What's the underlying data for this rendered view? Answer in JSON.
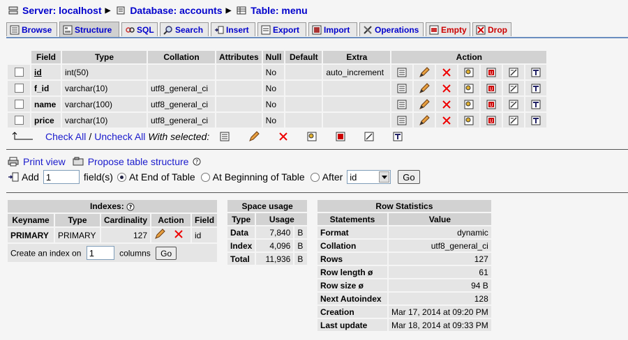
{
  "breadcrumb": {
    "server": "Server: localhost",
    "database": "Database: accounts",
    "table": "Table: menu"
  },
  "tabs": [
    {
      "label": "Browse",
      "icon": "browse-icon"
    },
    {
      "label": "Structure",
      "icon": "structure-icon",
      "active": true
    },
    {
      "label": "SQL",
      "icon": "sql-icon"
    },
    {
      "label": "Search",
      "icon": "search-icon"
    },
    {
      "label": "Insert",
      "icon": "insert-icon"
    },
    {
      "label": "Export",
      "icon": "export-icon"
    },
    {
      "label": "Import",
      "icon": "import-icon"
    },
    {
      "label": "Operations",
      "icon": "operations-icon"
    },
    {
      "label": "Empty",
      "icon": "empty-icon",
      "danger": true
    },
    {
      "label": "Drop",
      "icon": "drop-icon",
      "danger": true
    }
  ],
  "structure": {
    "headers": [
      "Field",
      "Type",
      "Collation",
      "Attributes",
      "Null",
      "Default",
      "Extra",
      "Action"
    ],
    "rows": [
      {
        "field": "id",
        "type": "int(50)",
        "collation": "",
        "attributes": "",
        "null": "No",
        "default": "",
        "extra": "auto_increment",
        "primary": true
      },
      {
        "field": "f_id",
        "type": "varchar(10)",
        "collation": "utf8_general_ci",
        "attributes": "",
        "null": "No",
        "default": "",
        "extra": ""
      },
      {
        "field": "name",
        "type": "varchar(100)",
        "collation": "utf8_general_ci",
        "attributes": "",
        "null": "No",
        "default": "",
        "extra": ""
      },
      {
        "field": "price",
        "type": "varchar(10)",
        "collation": "utf8_general_ci",
        "attributes": "",
        "null": "No",
        "default": "",
        "extra": ""
      }
    ]
  },
  "with_selected": {
    "check_all": "Check All",
    "separator": "/",
    "uncheck_all": "Uncheck All",
    "label": "With selected:"
  },
  "print_view": "Print view",
  "propose_structure": "Propose table structure",
  "add_fields": {
    "add_label": "Add",
    "count": "1",
    "fields_label": "field(s)",
    "opt_end": "At End of Table",
    "opt_begin": "At Beginning of Table",
    "opt_after": "After",
    "after_value": "id",
    "go": "Go"
  },
  "indexes": {
    "title": "Indexes:",
    "headers": [
      "Keyname",
      "Type",
      "Cardinality",
      "Action",
      "Field"
    ],
    "rows": [
      {
        "keyname": "PRIMARY",
        "type": "PRIMARY",
        "cardinality": "127",
        "field": "id"
      }
    ],
    "create_label": "Create an index on",
    "create_count": "1",
    "create_suffix": "columns",
    "go": "Go"
  },
  "space_usage": {
    "title": "Space usage",
    "headers": [
      "Type",
      "Usage"
    ],
    "rows": [
      {
        "type": "Data",
        "usage": "7,840",
        "unit": "B"
      },
      {
        "type": "Index",
        "usage": "4,096",
        "unit": "B"
      },
      {
        "type": "Total",
        "usage": "11,936",
        "unit": "B"
      }
    ]
  },
  "row_statistics": {
    "title": "Row Statistics",
    "headers": [
      "Statements",
      "Value"
    ],
    "rows": [
      {
        "label": "Format",
        "value": "dynamic"
      },
      {
        "label": "Collation",
        "value": "utf8_general_ci"
      },
      {
        "label": "Rows",
        "value": "127"
      },
      {
        "label": "Row length ø",
        "value": "61"
      },
      {
        "label": "Row size ø",
        "value": "94 B"
      },
      {
        "label": "Next Autoindex",
        "value": "128"
      },
      {
        "label": "Creation",
        "value": "Mar 17, 2014 at 09:20 PM"
      },
      {
        "label": "Last update",
        "value": "Mar 18, 2014 at 09:33 PM"
      }
    ]
  }
}
